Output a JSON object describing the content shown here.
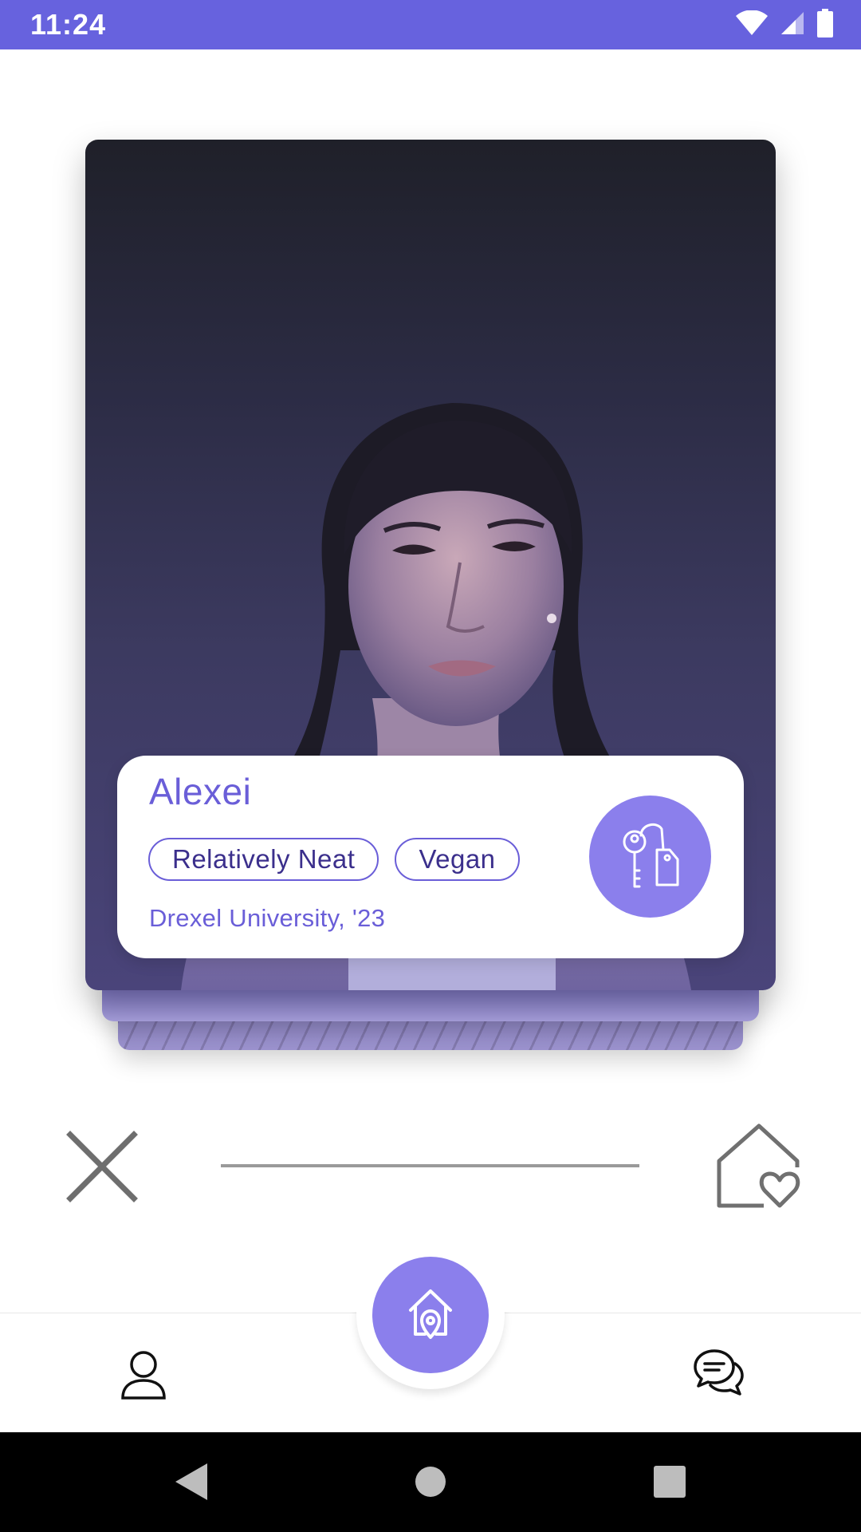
{
  "status_bar": {
    "time": "11:24",
    "icons": [
      "wifi-icon",
      "cell-signal-icon",
      "battery-icon"
    ]
  },
  "card": {
    "name": "Alexei",
    "tags": [
      "Relatively Neat",
      "Vegan"
    ],
    "school": "Drexel University, '23",
    "action_icon": "keys-tag-icon"
  },
  "actions": {
    "reject_icon": "close-icon",
    "like_icon": "house-heart-icon"
  },
  "bottom_nav": {
    "items": [
      "user-icon",
      "home-location-icon",
      "chat-bubbles-icon"
    ]
  },
  "system_nav": {
    "items": [
      "back-icon",
      "home-icon",
      "recents-icon"
    ]
  },
  "colors": {
    "accent": "#6762de",
    "accent_light": "#8b7fec",
    "text_accent": "#6a5ed8",
    "tag_text": "#3b2f8c"
  }
}
